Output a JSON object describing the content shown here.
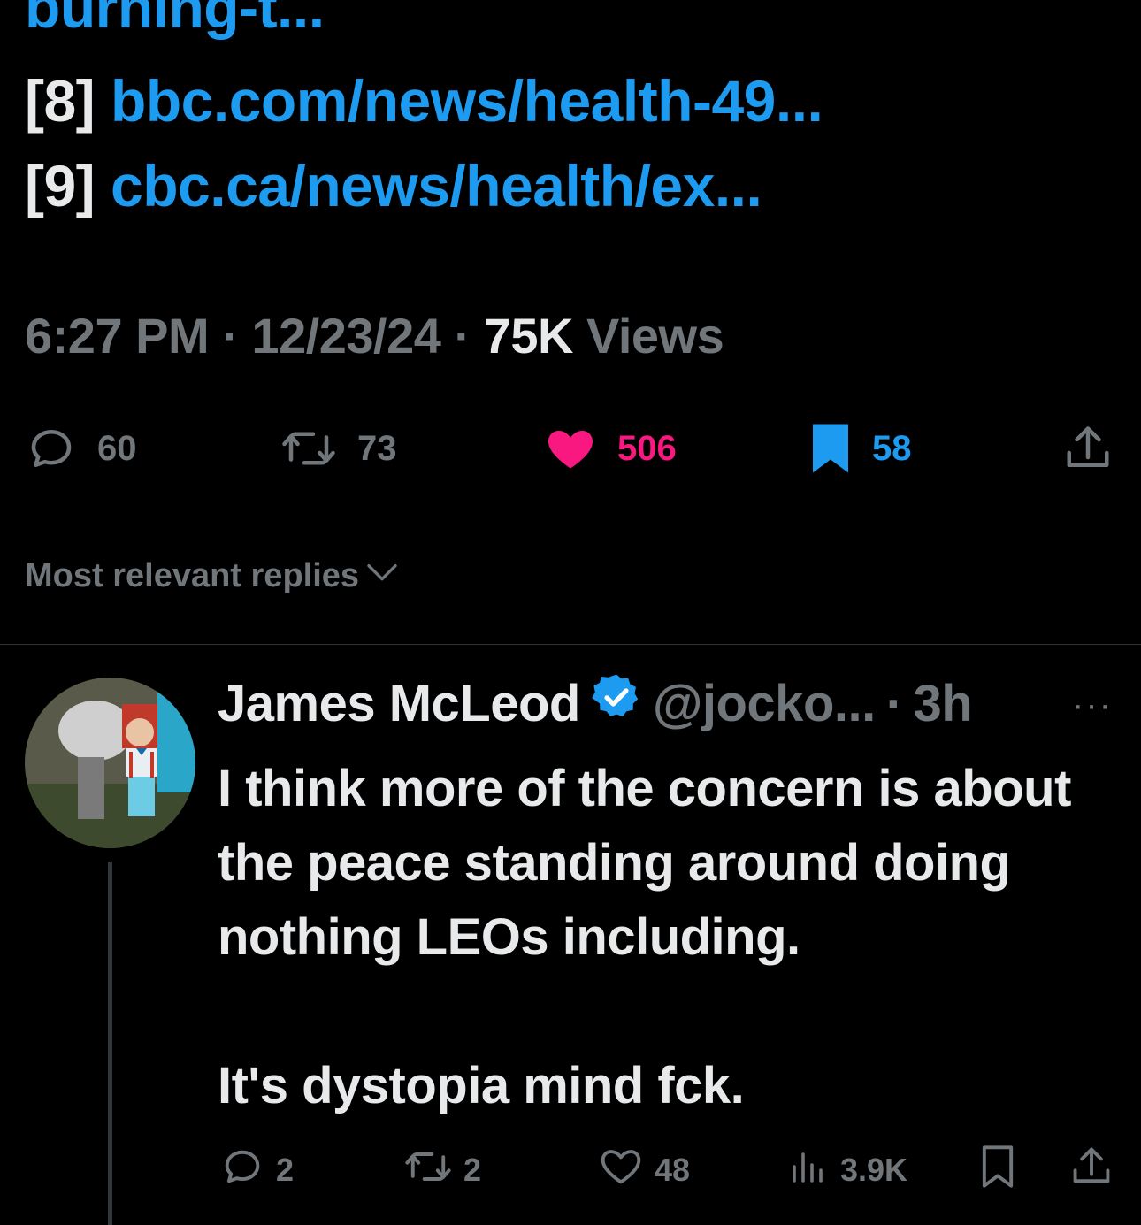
{
  "tweet": {
    "refs": {
      "truncated_prev": "burning-t...",
      "r8": {
        "num": "[8]",
        "link": "bbc.com/news/health-49..."
      },
      "r9": {
        "num": "[9]",
        "link": "cbc.ca/news/health/ex..."
      }
    },
    "meta": {
      "time": "6:27 PM",
      "sep1": "·",
      "date": "12/23/24",
      "sep2": "·",
      "views_count": "75K",
      "views_label": "Views"
    },
    "actions": {
      "replies": "60",
      "reposts": "73",
      "likes": "506",
      "bookmarks": "58"
    },
    "colors": {
      "like": "#f91880",
      "bookmark": "#1d9bf0",
      "link": "#1d9bf0"
    }
  },
  "sort": {
    "label": "Most relevant replies"
  },
  "reply": {
    "name": "James McLeod",
    "handle": "@jocko...",
    "sep": "·",
    "time": "3h",
    "more": "···",
    "body_1": "I think more of the concern is about the peace standing around doing nothing LEOs including.",
    "body_2": "It's dystopia mind fck.",
    "actions": {
      "replies": "2",
      "reposts": "2",
      "likes": "48",
      "views": "3.9K"
    }
  }
}
